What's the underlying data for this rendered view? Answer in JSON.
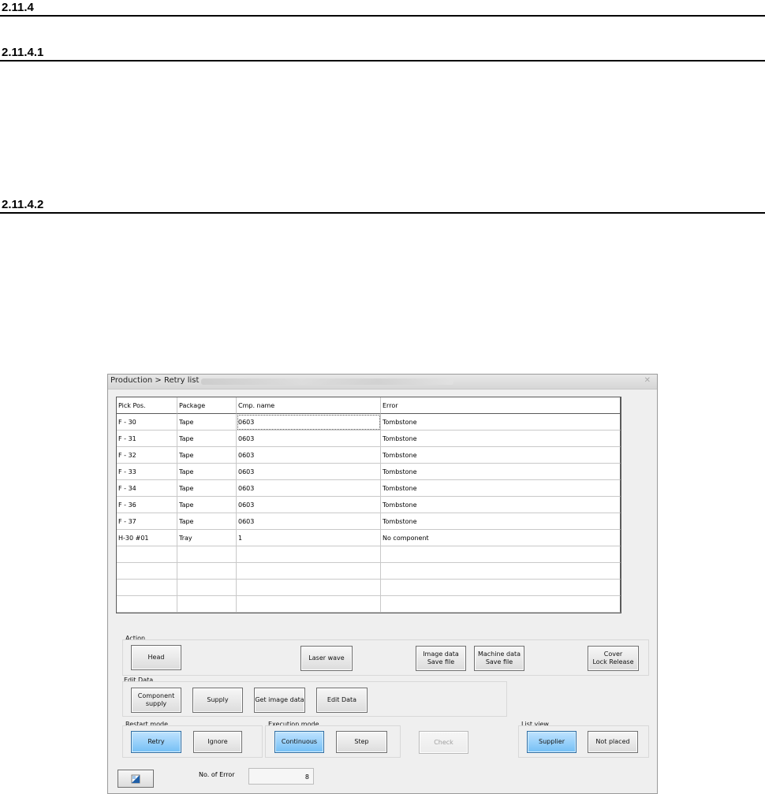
{
  "headings": [
    "2.11.4",
    "2.11.4.1",
    "2.11.4.2"
  ],
  "window": {
    "title": "Production > Retry list"
  },
  "table": {
    "columns": [
      "Pick Pos.",
      "Package",
      "Cmp. name",
      "Error"
    ],
    "rows": [
      [
        "F - 30",
        "Tape",
        "0603",
        "Tombstone"
      ],
      [
        "F - 31",
        "Tape",
        "0603",
        "Tombstone"
      ],
      [
        "F - 32",
        "Tape",
        "0603",
        "Tombstone"
      ],
      [
        "F - 33",
        "Tape",
        "0603",
        "Tombstone"
      ],
      [
        "F - 34",
        "Tape",
        "0603",
        "Tombstone"
      ],
      [
        "F - 36",
        "Tape",
        "0603",
        "Tombstone"
      ],
      [
        "F - 37",
        "Tape",
        "0603",
        "Tombstone"
      ],
      [
        "H-30 #01",
        "Tray",
        "1",
        "No component"
      ]
    ],
    "empty_rows": 4
  },
  "action": {
    "label": "Action",
    "head": "Head",
    "laser_wave": "Laser wave",
    "image_data_save": "Image data\nSave file",
    "machine_data_save": "Machine data\nSave file",
    "cover_lock_release": "Cover\nLock Release"
  },
  "edit_data": {
    "label": "Edit Data",
    "component_supply": "Component\nsupply",
    "supply": "Supply",
    "get_image_data": "Get image data",
    "edit_data": "Edit Data"
  },
  "restart_mode": {
    "label": "Restart mode",
    "retry": "Retry",
    "ignore": "Ignore"
  },
  "execution_mode": {
    "label": "Execution mode",
    "continuous": "Continuous",
    "step": "Step"
  },
  "check": "Check",
  "list_view": {
    "label": "List view",
    "supplier": "Supplier",
    "not_placed": "Not placed"
  },
  "errors": {
    "label": "No. of Error",
    "value": "8"
  },
  "icons": {
    "bottom_left": "window-restore-icon"
  },
  "colors": {
    "selected_button": "#74bff5"
  }
}
